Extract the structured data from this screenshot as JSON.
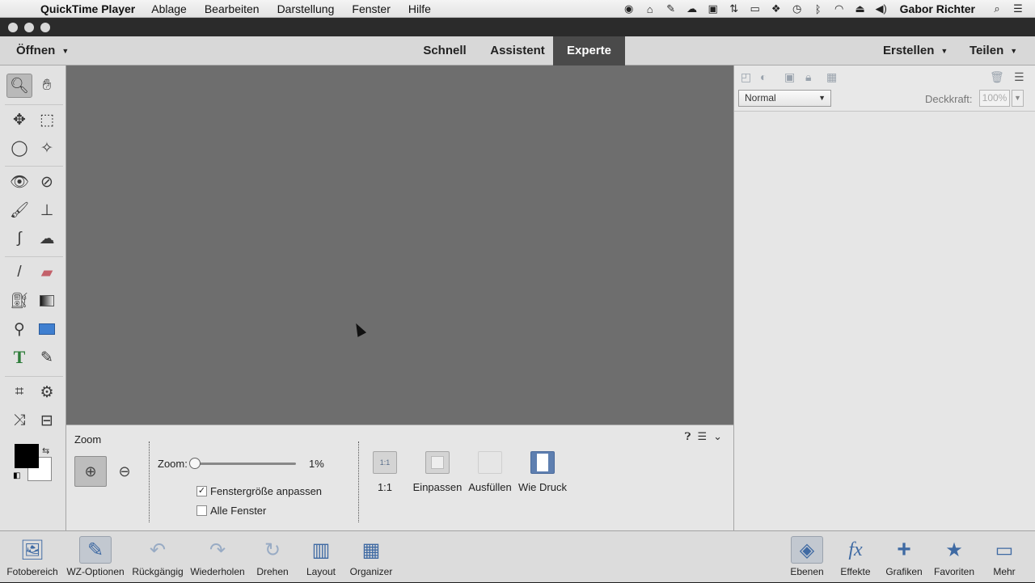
{
  "menubar": {
    "app_name": "QuickTime Player",
    "items": [
      "Ablage",
      "Bearbeiten",
      "Darstellung",
      "Fenster",
      "Hilfe"
    ],
    "user_name": "Gabor Richter",
    "status_icons": [
      "record-icon",
      "home-icon",
      "evernote-icon",
      "cloud-icon",
      "display-icon",
      "network-icon",
      "airplay-icon",
      "dropbox-icon",
      "time-machine-icon",
      "bluetooth-icon",
      "wifi-icon",
      "eject-icon",
      "volume-icon"
    ]
  },
  "header": {
    "open_label": "Öffnen",
    "tabs": [
      {
        "label": "Schnell",
        "active": false
      },
      {
        "label": "Assistent",
        "active": false
      },
      {
        "label": "Experte",
        "active": true
      }
    ],
    "create_label": "Erstellen",
    "share_label": "Teilen"
  },
  "tools": {
    "selected": "zoom-tool",
    "foreground_color": "#000000",
    "background_color": "#ffffff"
  },
  "options": {
    "title": "Zoom",
    "zoom_label": "Zoom:",
    "zoom_value": "1%",
    "zoom_fraction": 0.0,
    "resize_windows_label": "Fenstergröße anpassen",
    "resize_windows_checked": true,
    "all_windows_label": "Alle Fenster",
    "all_windows_checked": false,
    "view_buttons": [
      {
        "label": "1:1",
        "icon_text": "1:1"
      },
      {
        "label": "Einpassen",
        "icon_text": ""
      },
      {
        "label": "Ausfüllen",
        "icon_text": ""
      },
      {
        "label": "Wie Druck",
        "icon_text": ""
      }
    ]
  },
  "panel": {
    "blend_mode": "Normal",
    "opacity_label": "Deckkraft:",
    "opacity_value": "100%"
  },
  "taskbar": {
    "left": [
      {
        "label": "Fotobereich",
        "active": false
      },
      {
        "label": "WZ-Optionen",
        "active": true
      },
      {
        "label": "Rückgängig",
        "active": false
      },
      {
        "label": "Wiederholen",
        "active": false
      },
      {
        "label": "Drehen",
        "active": false
      },
      {
        "label": "Layout",
        "active": false
      },
      {
        "label": "Organizer",
        "active": false
      }
    ],
    "right": [
      {
        "label": "Ebenen",
        "active": true
      },
      {
        "label": "Effekte",
        "active": false
      },
      {
        "label": "Grafiken",
        "active": false
      },
      {
        "label": "Favoriten",
        "active": false
      },
      {
        "label": "Mehr",
        "active": false
      }
    ]
  },
  "colors": {
    "canvas": "#6e6e6e",
    "active_tab": "#4a4a4a",
    "accent": "#3f6aa3"
  }
}
